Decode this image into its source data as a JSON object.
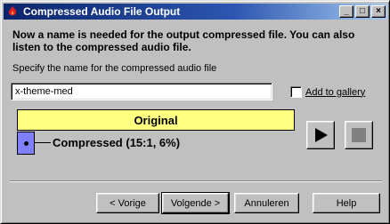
{
  "window": {
    "title": "Compressed Audio File Output",
    "minimize_glyph": "_",
    "maximize_glyph": "□",
    "close_glyph": "×",
    "app_icon": "red-flame-icon"
  },
  "content": {
    "heading": "Now a name is needed for the output compressed file.  You can also listen to the compressed audio file.",
    "prompt": "Specify the name for the compressed audio file",
    "name_value": "x-theme-med",
    "gallery_label": "Add to gallery",
    "gallery_checked": false
  },
  "comparison": {
    "original_label": "Original",
    "original_color": "#ffff80",
    "compressed_label": "Compressed (15:1, 6%)",
    "compressed_color": "#8080ff",
    "compressed_ratio": "15:1",
    "compressed_percent": 6
  },
  "media": {
    "play_icon": "play-icon",
    "stop_icon": "stop-icon"
  },
  "buttons": {
    "prev": "< Vorige",
    "next": "Volgende >",
    "cancel": "Annuleren",
    "help": "Help"
  }
}
